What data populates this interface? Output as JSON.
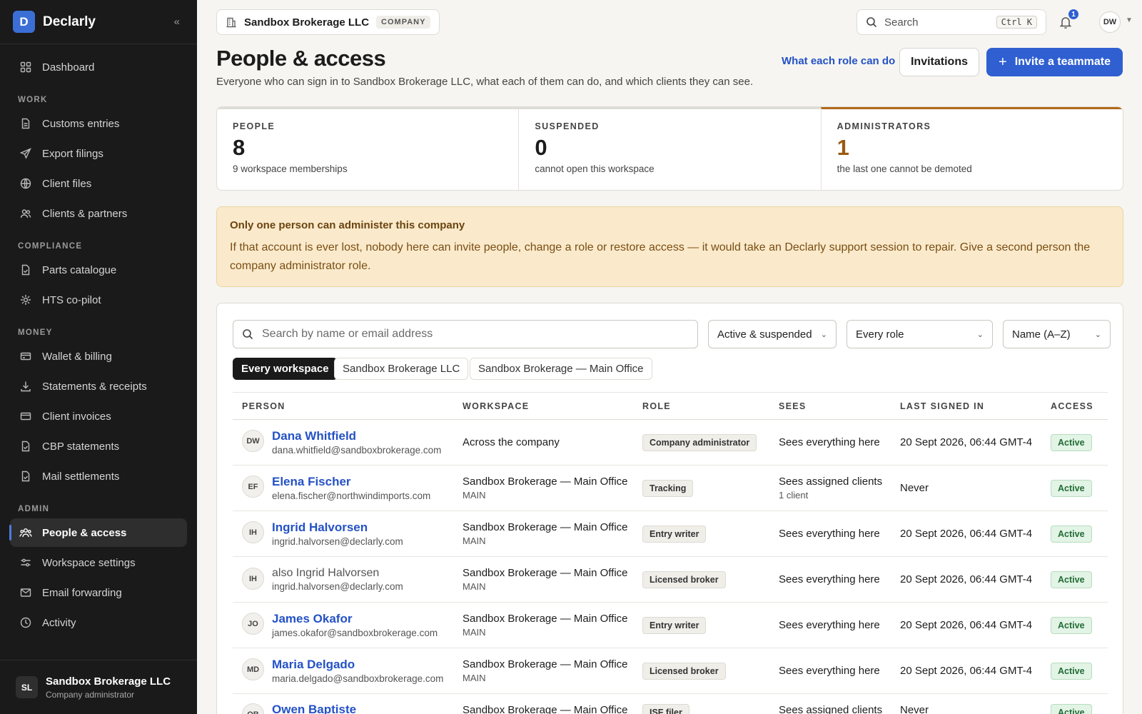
{
  "brand": {
    "initial": "D",
    "name": "Declarly",
    "collapse_icon": "«"
  },
  "sidebar": {
    "dashboard": "Dashboard",
    "sections": {
      "work": "WORK",
      "compliance": "COMPLIANCE",
      "money": "MONEY",
      "admin": "ADMIN"
    },
    "items": {
      "customs": "Customs entries",
      "export": "Export filings",
      "files": "Client files",
      "clients": "Clients & partners",
      "parts": "Parts catalogue",
      "hts": "HTS co-pilot",
      "wallet": "Wallet & billing",
      "statements": "Statements & receipts",
      "invoices": "Client invoices",
      "cbp": "CBP statements",
      "mail": "Mail settlements",
      "people": "People & access",
      "settings": "Workspace settings",
      "email": "Email forwarding",
      "activity": "Activity"
    },
    "footer": {
      "initials": "SL",
      "name": "Sandbox Brokerage LLC",
      "role": "Company administrator"
    }
  },
  "topbar": {
    "workspace": "Sandbox Brokerage LLC",
    "workspace_tag": "COMPANY",
    "search_label": "Search",
    "search_kbd": "Ctrl K",
    "notif_count": "1",
    "user_initials": "DW"
  },
  "header": {
    "title": "People & access",
    "subtitle": "Everyone who can sign in to Sandbox Brokerage LLC, what each of them can do, and which clients they can see.",
    "role_link": "What each role can do",
    "invitations": "Invitations",
    "invite": "Invite a teammate"
  },
  "stats": [
    {
      "label": "PEOPLE",
      "value": "8",
      "desc": "9 workspace memberships"
    },
    {
      "label": "SUSPENDED",
      "value": "0",
      "desc": "cannot open this workspace"
    },
    {
      "label": "ADMINISTRATORS",
      "value": "1",
      "desc": "the last one cannot be demoted"
    }
  ],
  "warning": {
    "title": "Only one person can administer this company",
    "body": "If that account is ever lost, nobody here can invite people, change a role or restore access — it would take an Declarly support session to repair. Give a second person the company administrator role."
  },
  "filters": {
    "search_placeholder": "Search by name or email address",
    "status": "Active & suspended",
    "role": "Every role",
    "sort": "Name (A–Z)",
    "segments": [
      "Every workspace",
      "Sandbox Brokerage LLC",
      "Sandbox Brokerage — Main Office"
    ]
  },
  "table": {
    "headers": [
      "PERSON",
      "WORKSPACE",
      "ROLE",
      "SEES",
      "LAST SIGNED IN",
      "ACCESS"
    ],
    "rows": [
      {
        "initials": "DW",
        "name": "Dana Whitfield",
        "email": "dana.whitfield@sandboxbrokerage.com",
        "workspace": "Across the company",
        "ws_sub": "",
        "role": "Company administrator",
        "sees": "Sees everything here",
        "sees_sub": "",
        "last": "20 Sept 2026, 06:44 GMT-4",
        "access": "Active"
      },
      {
        "initials": "EF",
        "name": "Elena Fischer",
        "email": "elena.fischer@northwindimports.com",
        "workspace": "Sandbox Brokerage — Main Office",
        "ws_sub": "MAIN",
        "role": "Tracking",
        "sees": "Sees assigned clients",
        "sees_sub": "1 client",
        "last": "Never",
        "access": "Active"
      },
      {
        "initials": "IH",
        "name": "Ingrid Halvorsen",
        "email": "ingrid.halvorsen@declarly.com",
        "workspace": "Sandbox Brokerage — Main Office",
        "ws_sub": "MAIN",
        "role": "Entry writer",
        "sees": "Sees everything here",
        "sees_sub": "",
        "last": "20 Sept 2026, 06:44 GMT-4",
        "access": "Active"
      },
      {
        "initials": "IH",
        "name": "also Ingrid Halvorsen",
        "email": "ingrid.halvorsen@declarly.com",
        "workspace": "Sandbox Brokerage — Main Office",
        "ws_sub": "MAIN",
        "role": "Licensed broker",
        "sees": "Sees everything here",
        "sees_sub": "",
        "last": "20 Sept 2026, 06:44 GMT-4",
        "access": "Active"
      },
      {
        "initials": "JO",
        "name": "James Okafor",
        "email": "james.okafor@sandboxbrokerage.com",
        "workspace": "Sandbox Brokerage — Main Office",
        "ws_sub": "MAIN",
        "role": "Entry writer",
        "sees": "Sees everything here",
        "sees_sub": "",
        "last": "20 Sept 2026, 06:44 GMT-4",
        "access": "Active"
      },
      {
        "initials": "MD",
        "name": "Maria Delgado",
        "email": "maria.delgado@sandboxbrokerage.com",
        "workspace": "Sandbox Brokerage — Main Office",
        "ws_sub": "MAIN",
        "role": "Licensed broker",
        "sees": "Sees everything here",
        "sees_sub": "",
        "last": "20 Sept 2026, 06:44 GMT-4",
        "access": "Active"
      },
      {
        "initials": "OB",
        "name": "Owen Baptiste",
        "email": "",
        "workspace": "Sandbox Brokerage — Main Office",
        "ws_sub": "",
        "role": "ISF filer",
        "sees": "Sees assigned clients",
        "sees_sub": "",
        "last": "Never",
        "access": "Active"
      }
    ]
  }
}
